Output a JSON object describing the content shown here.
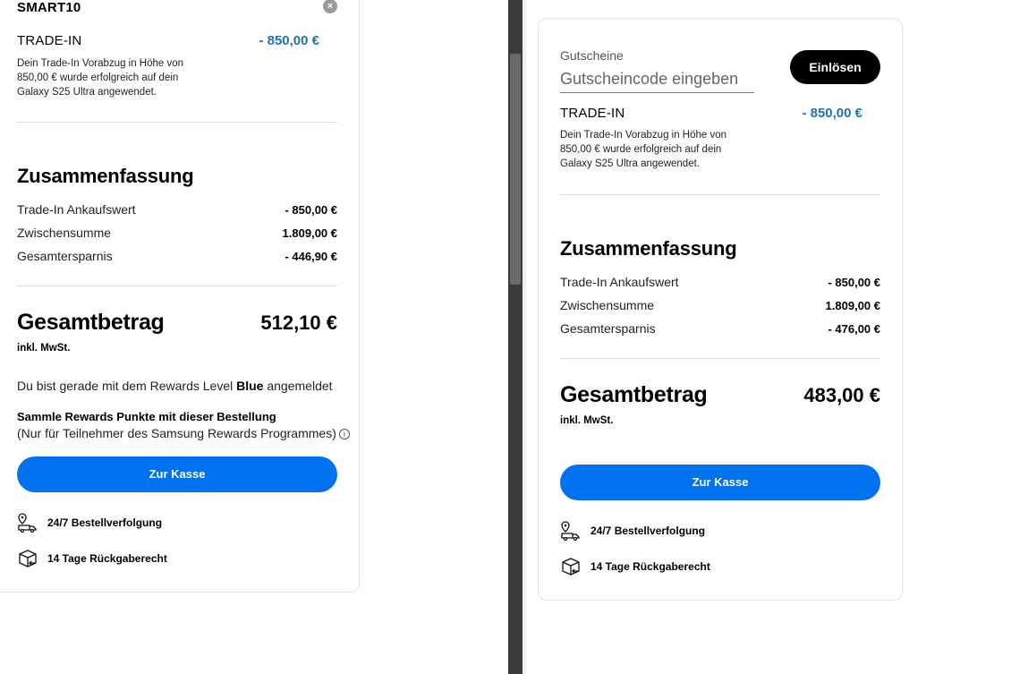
{
  "left_panel": {
    "coupon_code": "SMART10",
    "trade_in": {
      "label": "TRADE-IN",
      "amount": "- 850,00 €",
      "description": "Dein Trade-In Vorabzug in Höhe von 850,00 € wurde erfolgreich auf dein Galaxy S25 Ultra angewendet."
    },
    "summary": {
      "title": "Zusammenfassung",
      "rows": [
        {
          "label": "Trade-In Ankaufswert",
          "value": "- 850,00 €"
        },
        {
          "label": "Zwischensumme",
          "value": "1.809,00 €"
        },
        {
          "label": "Gesamtersparnis",
          "value": "- 446,90 €"
        }
      ]
    },
    "total": {
      "label": "Gesamtbetrag",
      "value": "512,10 €",
      "vat": "inkl. MwSt."
    },
    "rewards": {
      "prefix": "Du bist gerade mit dem Rewards Level",
      "level": "Blue",
      "suffix": "angemeldet",
      "collect_title": "Sammle Rewards Punkte mit dieser Bestellung",
      "collect_sub": "(Nur für Teilnehmer des Samsung Rewards Programmes)"
    },
    "checkout_label": "Zur Kasse",
    "features": [
      "24/7 Bestellverfolgung",
      "14 Tage Rückgaberecht"
    ]
  },
  "right_panel": {
    "voucher": {
      "label": "Gutscheine",
      "placeholder": "Gutscheincode eingeben",
      "redeem_label": "Einlösen"
    },
    "trade_in": {
      "label": "TRADE-IN",
      "amount": "- 850,00 €",
      "description": "Dein Trade-In Vorabzug in Höhe von 850,00 € wurde erfolgreich auf dein Galaxy S25 Ultra angewendet."
    },
    "summary": {
      "title": "Zusammenfassung",
      "rows": [
        {
          "label": "Trade-In Ankaufswert",
          "value": "- 850,00 €"
        },
        {
          "label": "Zwischensumme",
          "value": "1.809,00 €"
        },
        {
          "label": "Gesamtersparnis",
          "value": "- 476,00 €"
        }
      ]
    },
    "total": {
      "label": "Gesamtbetrag",
      "value": "483,00 €",
      "vat": "inkl. MwSt."
    },
    "checkout_label": "Zur Kasse",
    "features": [
      "24/7 Bestellverfolgung",
      "14 Tage Rückgaberecht"
    ]
  },
  "colors": {
    "accent_blue": "#0072f0",
    "trade_in_blue": "#2272b5",
    "dark_button": "#000000"
  },
  "icons": [
    "close-icon",
    "info-icon",
    "delivery-tracking-icon",
    "return-box-icon"
  ]
}
